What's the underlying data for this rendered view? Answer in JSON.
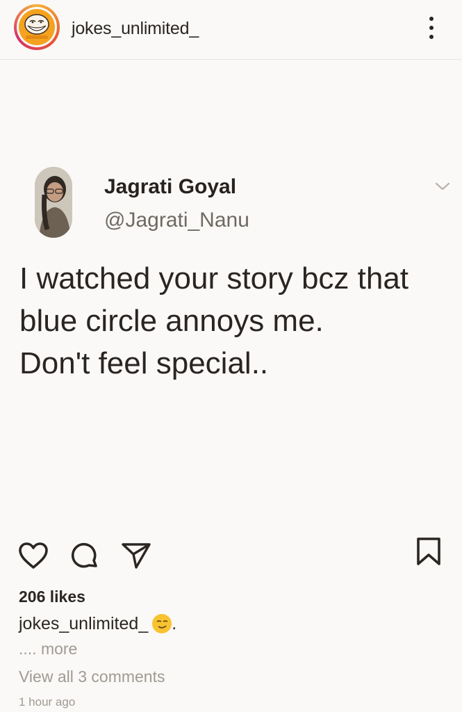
{
  "header": {
    "username": "jokes_unlimited_",
    "more_icon": "more-vertical-icon"
  },
  "tweet": {
    "name": "Jagrati Goyal",
    "handle": "@Jagrati_Nanu",
    "lines": [
      "I watched your story bcz that",
      "blue circle annoys me.",
      "Don't feel special.."
    ],
    "chevron_icon": "chevron-down-icon"
  },
  "actions": {
    "like_icon": "heart-icon",
    "comment_icon": "comment-icon",
    "share_icon": "send-icon",
    "save_icon": "bookmark-icon"
  },
  "post": {
    "likes": "206 likes",
    "caption_user": "jokes_unlimited_",
    "caption_end": ".",
    "more": ".... more",
    "view_comments": "View all 3 comments",
    "time": "1 hour ago"
  },
  "colors": {
    "text": "#2b2622",
    "muted": "#a19a93",
    "background": "#faf9f7",
    "avatar_orange": "#f4a21f"
  }
}
